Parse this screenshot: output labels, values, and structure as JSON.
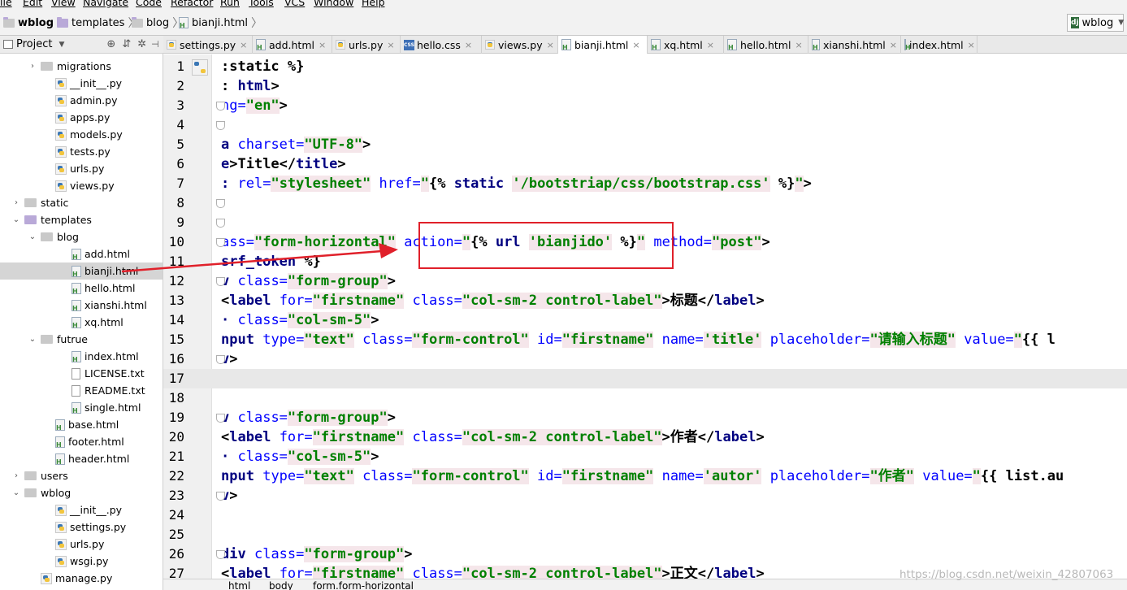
{
  "menu": [
    "ile",
    "Edit",
    "View",
    "Navigate",
    "Code",
    "Refactor",
    "Run",
    "Tools",
    "VCS",
    "Window",
    "Help"
  ],
  "breadcrumbs": [
    "wblog",
    "templates",
    "blog",
    "bianji.html"
  ],
  "run_config": "wblog",
  "project_panel": {
    "title": "Project"
  },
  "tree": [
    {
      "label": "migrations",
      "kind": "folder",
      "arrow": "›"
    },
    {
      "label": "__init__.py",
      "kind": "py"
    },
    {
      "label": "admin.py",
      "kind": "py"
    },
    {
      "label": "apps.py",
      "kind": "py"
    },
    {
      "label": "models.py",
      "kind": "py"
    },
    {
      "label": "tests.py",
      "kind": "py"
    },
    {
      "label": "urls.py",
      "kind": "py"
    },
    {
      "label": "views.py",
      "kind": "py"
    },
    {
      "label": "static",
      "kind": "folder",
      "arrow": "›"
    },
    {
      "label": "templates",
      "kind": "tpl",
      "arrow": "⌄"
    },
    {
      "label": "blog",
      "kind": "folder",
      "arrow": "⌄"
    },
    {
      "label": "add.html",
      "kind": "html"
    },
    {
      "label": "bianji.html",
      "kind": "html",
      "selected": true
    },
    {
      "label": "hello.html",
      "kind": "html"
    },
    {
      "label": "xianshi.html",
      "kind": "html"
    },
    {
      "label": "xq.html",
      "kind": "html"
    },
    {
      "label": "futrue",
      "kind": "folder",
      "arrow": "⌄"
    },
    {
      "label": "index.html",
      "kind": "html"
    },
    {
      "label": "LICENSE.txt",
      "kind": "txt"
    },
    {
      "label": "README.txt",
      "kind": "txt"
    },
    {
      "label": "single.html",
      "kind": "html"
    },
    {
      "label": "base.html",
      "kind": "html"
    },
    {
      "label": "footer.html",
      "kind": "html"
    },
    {
      "label": "header.html",
      "kind": "html"
    },
    {
      "label": "users",
      "kind": "folder",
      "arrow": "›"
    },
    {
      "label": "wblog",
      "kind": "folder",
      "arrow": "⌄"
    },
    {
      "label": "__init__.py",
      "kind": "py"
    },
    {
      "label": "settings.py",
      "kind": "py"
    },
    {
      "label": "urls.py",
      "kind": "py"
    },
    {
      "label": "wsgi.py",
      "kind": "py"
    },
    {
      "label": "manage.py",
      "kind": "py"
    }
  ],
  "tabs": [
    {
      "label": "settings.py",
      "kind": "py"
    },
    {
      "label": "add.html",
      "kind": "html"
    },
    {
      "label": "urls.py",
      "kind": "py"
    },
    {
      "label": "hello.css",
      "kind": "css"
    },
    {
      "label": "views.py",
      "kind": "py"
    },
    {
      "label": "bianji.html",
      "kind": "html",
      "active": true
    },
    {
      "label": "xq.html",
      "kind": "html"
    },
    {
      "label": "hello.html",
      "kind": "html"
    },
    {
      "label": "xianshi.html",
      "kind": "html"
    },
    {
      "label": "index.html",
      "kind": "html"
    }
  ],
  "code_lines": [
    {
      "n": "1",
      "html": "<span class=\"t\">:static %}</span>"
    },
    {
      "n": "2",
      "html": "<span class=\"t\">: </span><span class=\"k\">html</span><span class=\"t\">&gt;</span>"
    },
    {
      "n": "3",
      "html": "<span class=\"a\">ng=</span><span class=\"s\">\"en\"</span><span class=\"t\">&gt;</span>"
    },
    {
      "n": "4",
      "html": ""
    },
    {
      "n": "5",
      "html": "<span class=\"k\">a</span> <span class=\"a\">charset=</span><span class=\"s\">\"UTF-8\"</span><span class=\"t\">&gt;</span>"
    },
    {
      "n": "6",
      "html": "<span class=\"k\">e</span><span class=\"t\">&gt;Title&lt;/</span><span class=\"k\">title</span><span class=\"t\">&gt;</span>"
    },
    {
      "n": "7",
      "html": "<span class=\"k\">:</span> <span class=\"a\">rel=</span><span class=\"s\">\"stylesheet\"</span> <span class=\"a\">href=</span><span class=\"s\">\"</span><span class=\"t\">{% </span><span class=\"k\">static</span> <span class=\"s\">'/bootstriap/css/bootstrap.css'</span><span class=\"t\"> %}</span><span class=\"s\">\"</span><span class=\"t\">&gt;</span>"
    },
    {
      "n": "8",
      "html": ""
    },
    {
      "n": "9",
      "html": ""
    },
    {
      "n": "10",
      "html": "<span class=\"a\">ass=</span><span class=\"s\">\"form-horizontal\"</span> <span class=\"a\">action=</span><span class=\"s\">\"</span><span class=\"t\">{% </span><span class=\"k\">url</span> <span class=\"s\">'bianjido'</span><span class=\"t\"> %}</span><span class=\"s\">\"</span> <span class=\"a\">method=</span><span class=\"s\">\"post\"</span><span class=\"t\">&gt;</span>"
    },
    {
      "n": "11",
      "html": "<span class=\"k\">srf_token</span><span class=\"t\"> %}</span>"
    },
    {
      "n": "12",
      "html": "<span class=\"k\">v</span> <span class=\"a\">class=</span><span class=\"s\">\"form-group\"</span><span class=\"t\">&gt;</span>"
    },
    {
      "n": "13",
      "html": "<span class=\"t\">&lt;</span><span class=\"k\">label</span> <span class=\"a\">for=</span><span class=\"s\">\"firstname\"</span> <span class=\"a\">class=</span><span class=\"s\">\"col-sm-2 control-label\"</span><span class=\"t\">&gt;标题&lt;/</span><span class=\"k\">label</span><span class=\"t\">&gt;</span>"
    },
    {
      "n": "14",
      "html": "<span class=\"k\">·</span> <span class=\"a\">class=</span><span class=\"s\">\"col-sm-5\"</span><span class=\"t\">&gt;</span>"
    },
    {
      "n": "15",
      "html": "<span class=\"k\">nput</span> <span class=\"a\">type=</span><span class=\"s\">\"text\"</span> <span class=\"a\">class=</span><span class=\"s\">\"form-control\"</span> <span class=\"a\">id=</span><span class=\"s\">\"firstname\"</span> <span class=\"a\">name=</span><span class=\"s\">'title'</span> <span class=\"a\">placeholder=</span><span class=\"s\">\"请输入标题\"</span> <span class=\"a\">value=</span><span class=\"s\">\"</span><span class=\"t\">{{ l</span>"
    },
    {
      "n": "16",
      "html": "<span class=\"k\">v</span><span class=\"t\">&gt;</span>"
    },
    {
      "n": "17",
      "html": ""
    },
    {
      "n": "18",
      "html": ""
    },
    {
      "n": "19",
      "html": "<span class=\"k\">v</span> <span class=\"a\">class=</span><span class=\"s\">\"form-group\"</span><span class=\"t\">&gt;</span>"
    },
    {
      "n": "20",
      "html": "<span class=\"t\">&lt;</span><span class=\"k\">label</span> <span class=\"a\">for=</span><span class=\"s\">\"firstname\"</span> <span class=\"a\">class=</span><span class=\"s\">\"col-sm-2 control-label\"</span><span class=\"t\">&gt;作者&lt;/</span><span class=\"k\">label</span><span class=\"t\">&gt;</span>"
    },
    {
      "n": "21",
      "html": "<span class=\"k\">·</span> <span class=\"a\">class=</span><span class=\"s\">\"col-sm-5\"</span><span class=\"t\">&gt;</span>"
    },
    {
      "n": "22",
      "html": "<span class=\"k\">nput</span> <span class=\"a\">type=</span><span class=\"s\">\"text\"</span> <span class=\"a\">class=</span><span class=\"s\">\"form-control\"</span> <span class=\"a\">id=</span><span class=\"s\">\"firstname\"</span> <span class=\"a\">name=</span><span class=\"s\">'autor'</span> <span class=\"a\">placeholder=</span><span class=\"s\">\"作者\"</span> <span class=\"a\">value=</span><span class=\"s\">\"</span><span class=\"t\">{{ list.au</span>"
    },
    {
      "n": "23",
      "html": "<span class=\"k\">v</span><span class=\"t\">&gt;</span>"
    },
    {
      "n": "24",
      "html": ""
    },
    {
      "n": "25",
      "html": ""
    },
    {
      "n": "26",
      "html": "<span class=\"k\">div</span> <span class=\"a\">class=</span><span class=\"s\">\"form-group\"</span><span class=\"t\">&gt;</span>"
    },
    {
      "n": "27",
      "html": "<span class=\"t\">&lt;</span><span class=\"k\">label</span> <span class=\"a\">for=</span><span class=\"s\">\"firstname\"</span> <span class=\"a\">class=</span><span class=\"s\">\"col-sm-2 control-label\"</span><span class=\"t\">&gt;正文&lt;/</span><span class=\"k\">label</span><span class=\"t\">&gt;</span>"
    }
  ],
  "status_path": [
    "html",
    "body",
    "form.form-horizontal"
  ],
  "watermark": "https://blog.csdn.net/weixin_42807063"
}
